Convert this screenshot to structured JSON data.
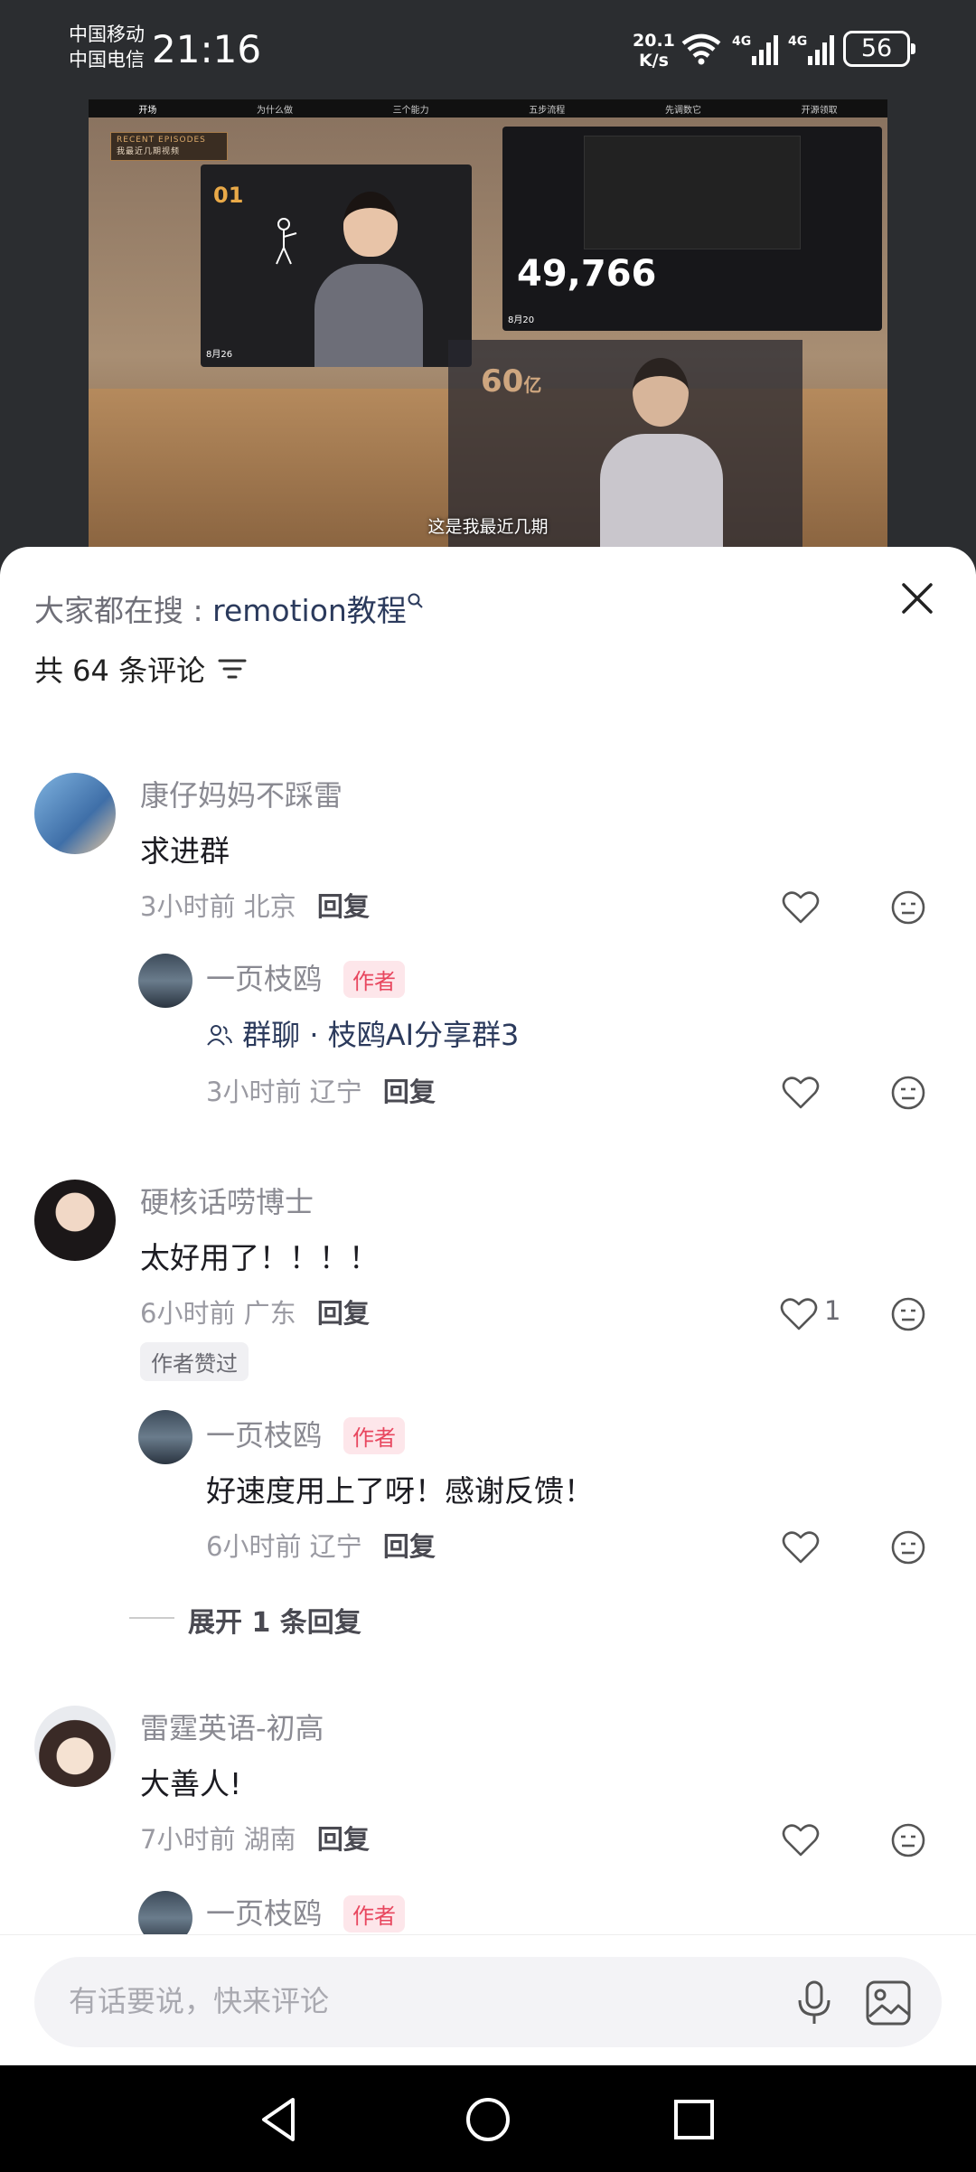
{
  "status_bar": {
    "carrier_1": "中国移动",
    "carrier_2": "中国电信",
    "time": "21:16",
    "net_speed_value": "20.1",
    "net_speed_unit": "K/s",
    "signal_1_label": "4G",
    "signal_2_label": "4G",
    "battery": "56",
    "icons": [
      "wifi-icon",
      "signal-icon",
      "signal-icon",
      "battery-icon"
    ]
  },
  "video": {
    "nav_tabs": [
      "开场",
      "为什么做",
      "三个能力",
      "五步流程",
      "先调数它",
      "开源领取"
    ],
    "badge_title": "RECENT EPISODES",
    "badge_sub": "我最近几期视频",
    "card1_number": "01",
    "card1_date": "8月26",
    "card2_number": "49,766",
    "card2_date": "8月20",
    "card3_number": "60",
    "card3_unit": "亿",
    "subtitle": "这是我最近几期"
  },
  "sheet": {
    "search_prefix": "大家都在搜 : ",
    "search_keyword": "remotion教程",
    "comment_count": "共 64 条评论"
  },
  "comments": [
    {
      "user": "康仔妈妈不踩雷",
      "text": "求进群",
      "time": "3小时前",
      "location": "北京",
      "reply_label": "回复",
      "reply": {
        "user": "一页枝鸥",
        "author_tag": "作者",
        "text": "群聊 · 枝鸥AI分享群3",
        "time": "3小时前",
        "location": "辽宁",
        "reply_label": "回复"
      }
    },
    {
      "user": "硬核话唠博士",
      "text": "太好用了！！！！",
      "time": "6小时前",
      "location": "广东",
      "reply_label": "回复",
      "likes": "1",
      "liked_by_author": "作者赞过",
      "reply": {
        "user": "一页枝鸥",
        "author_tag": "作者",
        "text": "好速度用上了呀！感谢反馈！",
        "time": "6小时前",
        "location": "辽宁",
        "reply_label": "回复"
      },
      "expand_label": "展开 1 条回复"
    },
    {
      "user": "雷霆英语-初高",
      "text": "大善人!",
      "time": "7小时前",
      "location": "湖南",
      "reply_label": "回复",
      "reply": {
        "user": "一页枝鸥",
        "author_tag": "作者"
      }
    }
  ],
  "input": {
    "placeholder": "有话要说，快来评论"
  },
  "colors": {
    "accent_author": "#e8475f",
    "link": "#2b3a5c"
  }
}
